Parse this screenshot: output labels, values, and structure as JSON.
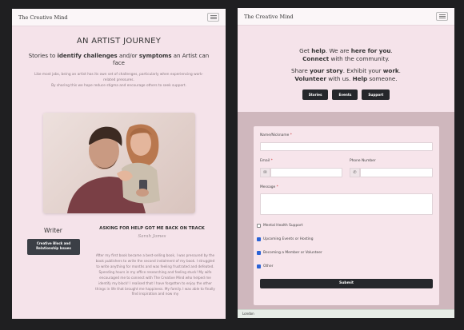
{
  "left": {
    "brand": "The Creative Mind",
    "title": "AN ARTIST JOURNEY",
    "subtitle": {
      "p1": "Stories to ",
      "b1": "identify challenges",
      "p2": " and/or ",
      "b2": "symptoms",
      "p3": " an Artist can face"
    },
    "desc1": "Like most jobs, being an artist has its own set of challenges, particularly when experiencing work-related pressures.",
    "desc2": "By sharing this we hope reduce stigma and encourage others to seek support.",
    "writer_label": "Writer",
    "tag_button": "Creative Block and Relationship Issues",
    "story_heading": "ASKING FOR HELP GOT ME BACK ON TRACK",
    "signature": "Sarah James",
    "story_text": "After my first book became a best-selling book, I was pressured by the book publishers to write the second instalment of my book. I struggled to write anything for months and was feeling frustrated and defeated. Spending hours in my office researching and feeling stuck! My wife encouraged me to connect with The Creative Mind who helped me identify my block! I realised that I have forgotten to enjoy the other things in life that brought me happiness. My family. I was able to finally find inspiration and now my"
  },
  "right": {
    "brand": "The Creative Mind",
    "hero": {
      "l1a": "Get ",
      "l1b": "help",
      "l1c": ". We are ",
      "l1d": "here for you",
      "l1e": ".",
      "l2a": "Connect",
      "l2b": " with the community.",
      "l3a": "Share ",
      "l3b": "your story",
      "l3c": ". Exhibit your ",
      "l3d": "work",
      "l3e": ".",
      "l4a": "Volunteer",
      "l4b": " with us. ",
      "l4c": "Help",
      "l4d": " someone."
    },
    "buttons": [
      "Stories",
      "Events",
      "Support"
    ],
    "form": {
      "name_label": "Name/Nickname",
      "email_label": "Email",
      "phone_label": "Phone Number",
      "message_label": "Message",
      "req": "*",
      "checkboxes": [
        {
          "label": "Mental Health Support",
          "checked": false
        },
        {
          "label": "Upcoming Events or Hosting",
          "checked": true
        },
        {
          "label": "Becoming a Member or Volunteer",
          "checked": true
        },
        {
          "label": "Other",
          "checked": true
        }
      ],
      "submit": "Submit"
    },
    "map_label": "London"
  },
  "colors": {
    "panel_bg": "#f5e3ea",
    "dark_button": "#25272b",
    "accent_check": "#2a63d6"
  }
}
